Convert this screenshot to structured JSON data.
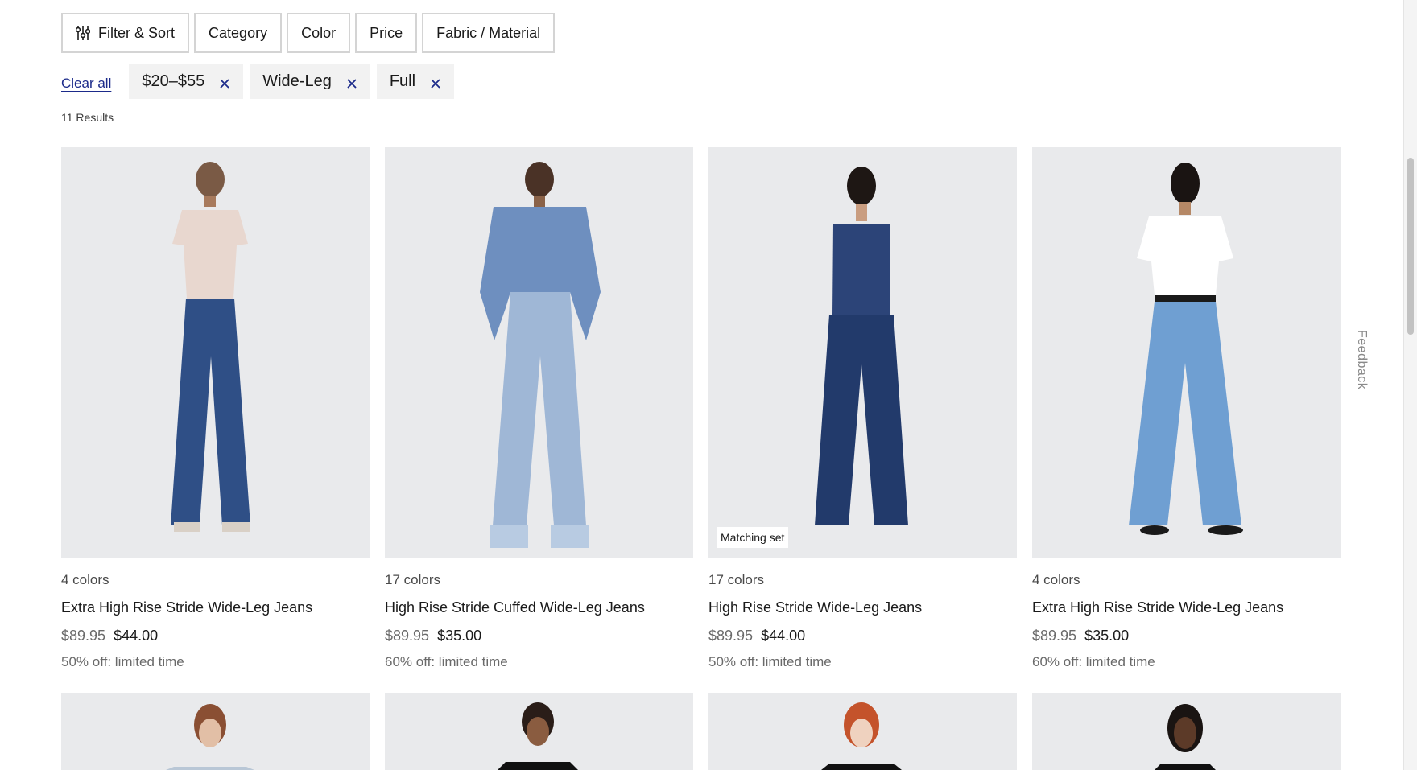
{
  "filters": {
    "filter_sort": "Filter & Sort",
    "category": "Category",
    "color": "Color",
    "price": "Price",
    "fabric": "Fabric / Material"
  },
  "applied": {
    "clear_all": "Clear all",
    "chips": [
      "$20–$55",
      "Wide-Leg",
      "Full"
    ]
  },
  "results_label": "11 Results",
  "products": [
    {
      "colors": "4 colors",
      "name": "Extra High Rise Stride Wide-Leg Jeans",
      "old_price": "$89.95",
      "price": "$44.00",
      "promo": "50% off: limited time",
      "badge": "",
      "top_color": "#e8d7cf",
      "jean_color": "#2f4f86"
    },
    {
      "colors": "17 colors",
      "name": "High Rise Stride Cuffed Wide-Leg Jeans",
      "old_price": "$89.95",
      "price": "$35.00",
      "promo": "60% off: limited time",
      "badge": "",
      "top_color": "#6e8fbf",
      "jean_color": "#9fb7d6"
    },
    {
      "colors": "17 colors",
      "name": "High Rise Stride Wide-Leg Jeans",
      "old_price": "$89.95",
      "price": "$44.00",
      "promo": "50% off: limited time",
      "badge": "Matching set",
      "top_color": "#2c4478",
      "jean_color": "#223a6b"
    },
    {
      "colors": "4 colors",
      "name": "Extra High Rise Stride Wide-Leg Jeans",
      "old_price": "$89.95",
      "price": "$35.00",
      "promo": "60% off: limited time",
      "badge": "",
      "top_color": "#ffffff",
      "jean_color": "#6f9fd2"
    }
  ],
  "feedback_label": "Feedback",
  "colors": {
    "accent": "#1b2a8a",
    "image_bg": "#e9eaec",
    "chip_bg": "#f2f2f2"
  }
}
